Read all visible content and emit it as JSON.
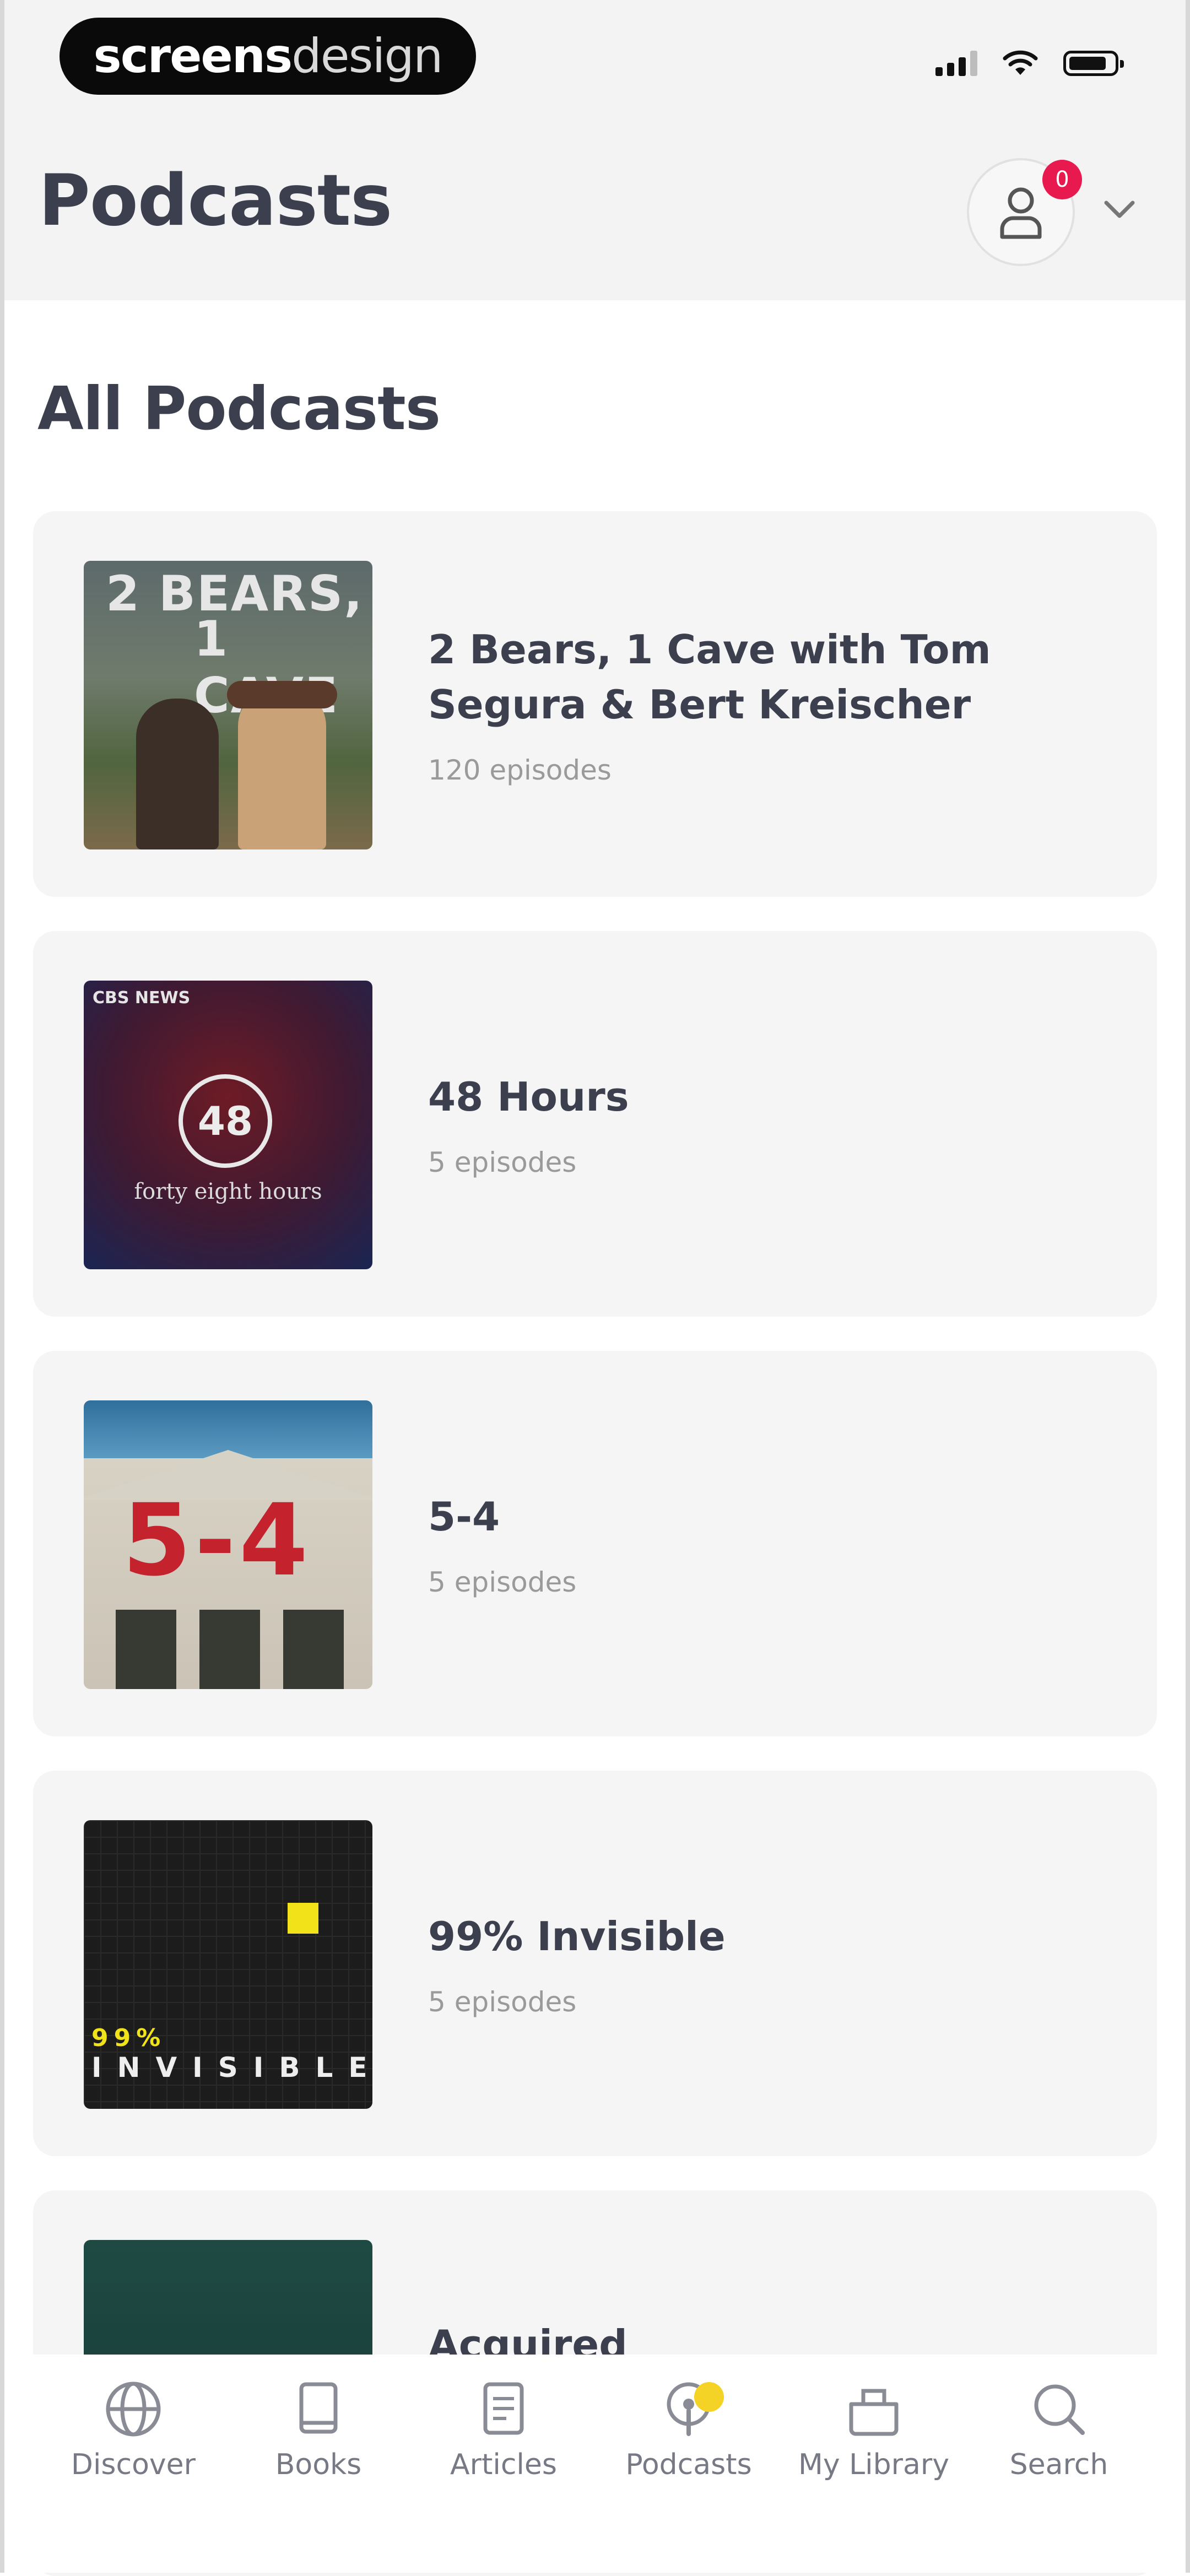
{
  "watermark": {
    "bold": "screens",
    "light": "design"
  },
  "header": {
    "title": "Podcasts",
    "profile_badge": "0"
  },
  "section": {
    "title": "All Podcasts"
  },
  "podcasts": [
    {
      "title": "2 Bears, 1 Cave with Tom Segura & Bert Kreischer",
      "episodes": "120 episodes",
      "cover_text_1": "2 BEARS,",
      "cover_text_2": "1 CAVE"
    },
    {
      "title": "48 Hours",
      "episodes": "5 episodes",
      "cover_brand": "CBS NEWS",
      "cover_number": "48",
      "cover_sub": "forty eight hours"
    },
    {
      "title": "5-4",
      "episodes": "5 episodes",
      "cover_text": "5-4"
    },
    {
      "title": "99% Invisible",
      "episodes": "5 episodes",
      "cover_pct": "99%",
      "cover_word": "INVISIBLE"
    },
    {
      "title": "Acquired",
      "episodes": ""
    }
  ],
  "tabs": [
    {
      "label": "Discover",
      "icon": "globe-icon"
    },
    {
      "label": "Books",
      "icon": "book-icon"
    },
    {
      "label": "Articles",
      "icon": "article-icon"
    },
    {
      "label": "Podcasts",
      "icon": "podcast-icon",
      "active": true
    },
    {
      "label": "My Library",
      "icon": "library-icon"
    },
    {
      "label": "Search",
      "icon": "search-icon"
    }
  ],
  "colors": {
    "badge": "#e8194f",
    "accent": "#f4d326",
    "card": "#f5f5f5",
    "header": "#f3f3f3"
  }
}
